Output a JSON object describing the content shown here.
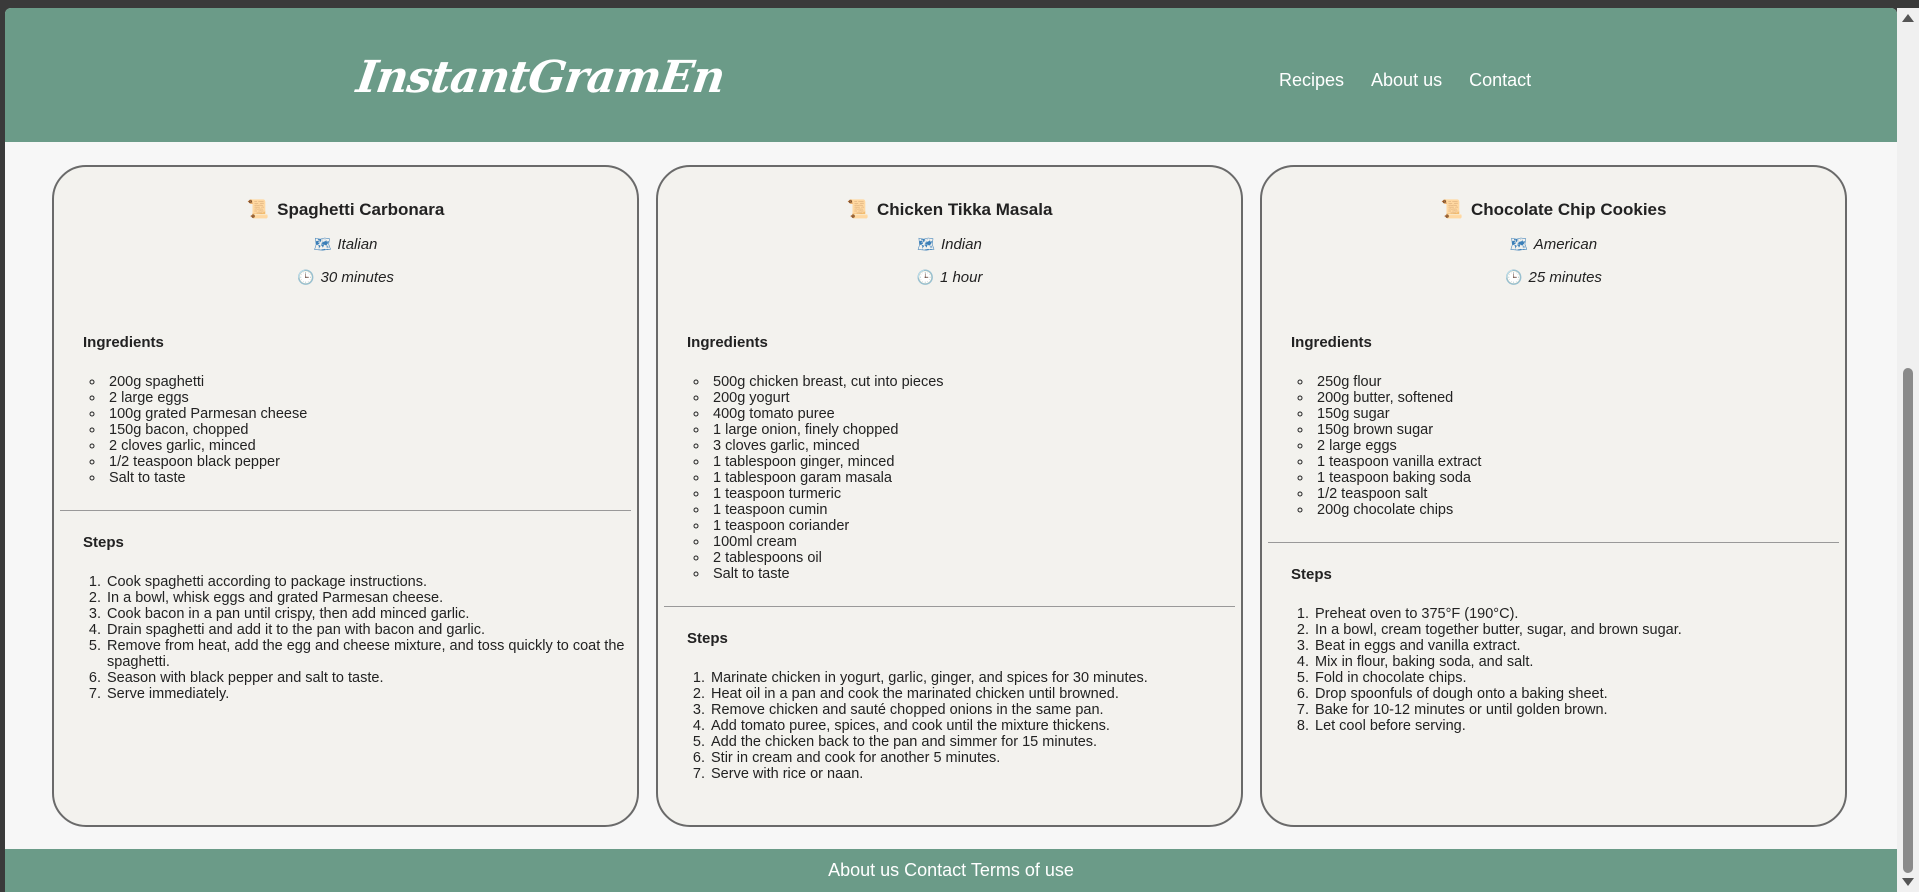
{
  "header": {
    "logo": "InstantGramEn",
    "nav": [
      "Recipes",
      "About us",
      "Contact"
    ]
  },
  "labels": {
    "ingredients": "Ingredients",
    "steps": "Steps"
  },
  "recipes": [
    {
      "title": "Spaghetti Carbonara",
      "cuisine": "Italian",
      "time": "30 minutes",
      "ingredients": [
        "200g spaghetti",
        "2 large eggs",
        "100g grated Parmesan cheese",
        "150g bacon, chopped",
        "2 cloves garlic, minced",
        "1/2 teaspoon black pepper",
        "Salt to taste"
      ],
      "steps": [
        "Cook spaghetti according to package instructions.",
        "In a bowl, whisk eggs and grated Parmesan cheese.",
        "Cook bacon in a pan until crispy, then add minced garlic.",
        "Drain spaghetti and add it to the pan with bacon and garlic.",
        "Remove from heat, add the egg and cheese mixture, and toss quickly to coat the spaghetti.",
        "Season with black pepper and salt to taste.",
        "Serve immediately."
      ]
    },
    {
      "title": "Chicken Tikka Masala",
      "cuisine": "Indian",
      "time": "1 hour",
      "ingredients": [
        "500g chicken breast, cut into pieces",
        "200g yogurt",
        "400g tomato puree",
        "1 large onion, finely chopped",
        "3 cloves garlic, minced",
        "1 tablespoon ginger, minced",
        "1 tablespoon garam masala",
        "1 teaspoon turmeric",
        "1 teaspoon cumin",
        "1 teaspoon coriander",
        "100ml cream",
        "2 tablespoons oil",
        "Salt to taste"
      ],
      "steps": [
        "Marinate chicken in yogurt, garlic, ginger, and spices for 30 minutes.",
        "Heat oil in a pan and cook the marinated chicken until browned.",
        "Remove chicken and sauté chopped onions in the same pan.",
        "Add tomato puree, spices, and cook until the mixture thickens.",
        "Add the chicken back to the pan and simmer for 15 minutes.",
        "Stir in cream and cook for another 5 minutes.",
        "Serve with rice or naan."
      ]
    },
    {
      "title": "Chocolate Chip Cookies",
      "cuisine": "American",
      "time": "25 minutes",
      "ingredients": [
        "250g flour",
        "200g butter, softened",
        "150g sugar",
        "150g brown sugar",
        "2 large eggs",
        "1 teaspoon vanilla extract",
        "1 teaspoon baking soda",
        "1/2 teaspoon salt",
        "200g chocolate chips"
      ],
      "steps": [
        "Preheat oven to 375°F (190°C).",
        "In a bowl, cream together butter, sugar, and brown sugar.",
        "Beat in eggs and vanilla extract.",
        "Mix in flour, baking soda, and salt.",
        "Fold in chocolate chips.",
        "Drop spoonfuls of dough onto a baking sheet.",
        "Bake for 10-12 minutes or until golden brown.",
        "Let cool before serving."
      ]
    }
  ],
  "footer": {
    "links": [
      "About us",
      "Contact",
      "Terms of use"
    ]
  },
  "icons": {
    "title": "scroll-icon",
    "cuisine": "map-icon",
    "time": "clock-icon"
  },
  "colors": {
    "header_bg": "#6b9b88",
    "card_bg": "#f3f2ee",
    "page_bg": "#f7f7f7"
  }
}
